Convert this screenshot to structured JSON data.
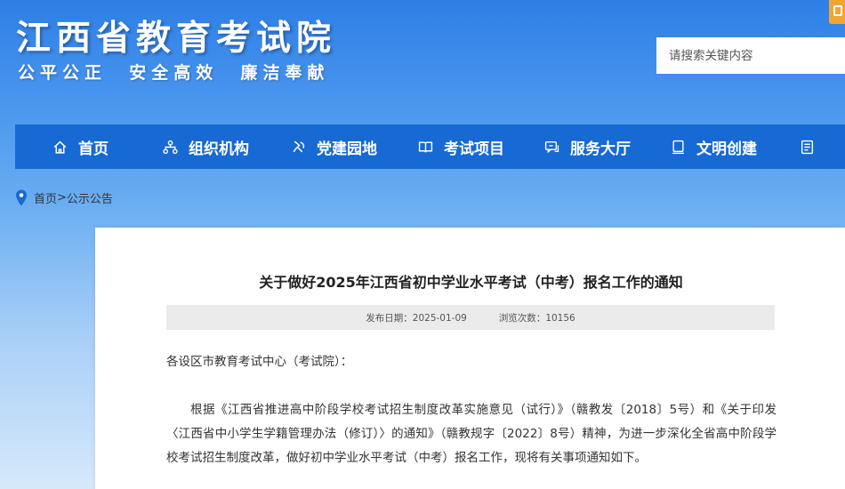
{
  "header": {
    "site_title": "江西省教育考试院",
    "slogan": "公平公正  安全高效  廉洁奉献"
  },
  "search": {
    "placeholder": "请搜索关键内容"
  },
  "nav": {
    "items": [
      {
        "label": "首页",
        "icon": "home-icon"
      },
      {
        "label": "组织机构",
        "icon": "org-chart-icon"
      },
      {
        "label": "党建园地",
        "icon": "party-building-icon"
      },
      {
        "label": "考试项目",
        "icon": "book-icon"
      },
      {
        "label": "服务大厅",
        "icon": "chat-service-icon"
      },
      {
        "label": "文明创建",
        "icon": "monitor-icon"
      },
      {
        "label": "",
        "icon": "document-icon"
      }
    ]
  },
  "breadcrumb": {
    "home": "首页",
    "separator": ">",
    "current": "公示公告",
    "icon": "location-pin-icon"
  },
  "article": {
    "title": "关于做好2025年江西省初中学业水平考试（中考）报名工作的通知",
    "publish_date_label": "发布日期：",
    "publish_date": "2025-01-09",
    "views_label": "浏览次数：",
    "views": "10156",
    "salutation": "各设区市教育考试中心（考试院）：",
    "body_1": "根据《江西省推进高中阶段学校考试招生制度改革实施意见（试行）》（赣教发〔2018〕5号）和《关于印发〈江西省中小学生学籍管理办法（修订）〉的通知》（赣教规字〔2022〕8号）精神，为进一步深化全省高中阶段学校考试招生制度改革，做好初中学业水平考试（中考）报名工作，现将有关事项通知如下。"
  },
  "colors": {
    "nav_bg": "#1769d4",
    "top_tab": "#f2a632",
    "location_pin": "#1769d4"
  }
}
